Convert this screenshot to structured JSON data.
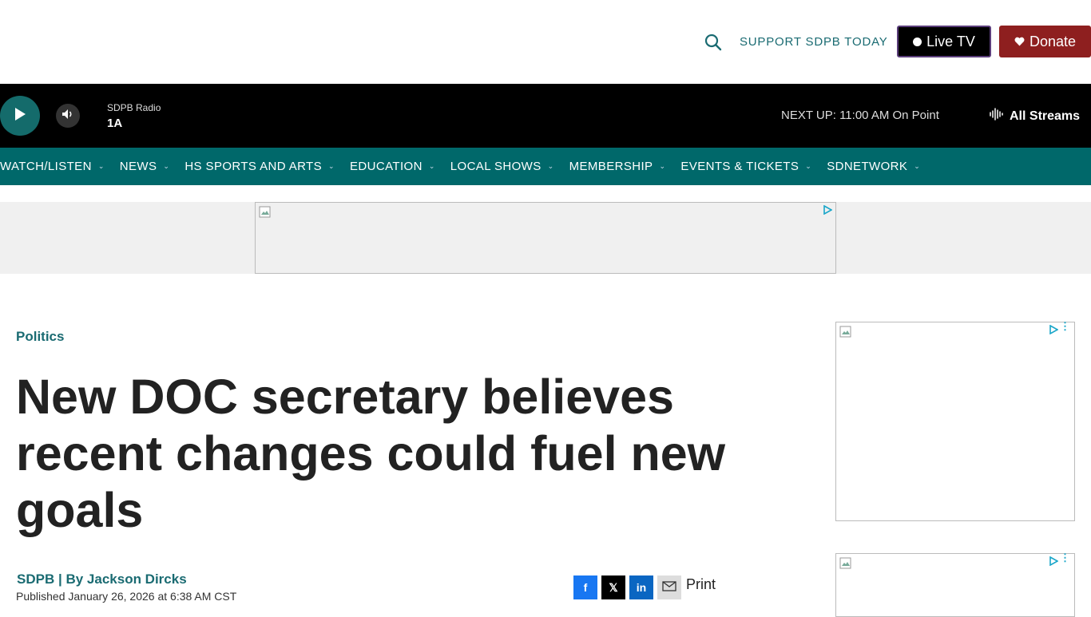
{
  "header": {
    "support_label": "SUPPORT SDPB TODAY",
    "live_tv_label": "Live TV",
    "donate_label": "Donate"
  },
  "player": {
    "station": "SDPB Radio",
    "program": "1A",
    "next_up": "NEXT UP: 11:00 AM On Point",
    "all_streams": "All Streams"
  },
  "nav": {
    "items": [
      {
        "label": "WATCH/LISTEN"
      },
      {
        "label": "NEWS"
      },
      {
        "label": "HS SPORTS AND ARTS"
      },
      {
        "label": "EDUCATION"
      },
      {
        "label": "LOCAL SHOWS"
      },
      {
        "label": "MEMBERSHIP"
      },
      {
        "label": "EVENTS & TICKETS"
      },
      {
        "label": "SDNETWORK"
      }
    ]
  },
  "article": {
    "category": "Politics",
    "headline": "New DOC secretary believes recent changes could fuel new goals",
    "source": "SDPB",
    "by": "| By",
    "author": "Jackson Dircks",
    "published": "Published January 26, 2026 at 6:38 AM CST"
  },
  "share": {
    "facebook": "f",
    "x": "𝕏",
    "linkedin": "in",
    "print_label": "Print"
  },
  "colors": {
    "brand_teal": "#00686a",
    "donate_red": "#8e1f1f",
    "link_teal": "#1a6b72"
  }
}
